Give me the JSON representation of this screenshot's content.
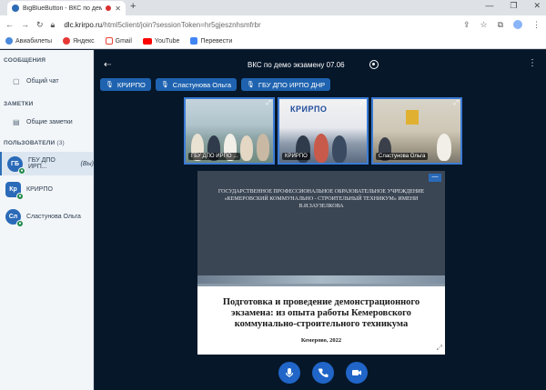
{
  "browser": {
    "tab_title": "BigBlueButton - ВКС по дем...",
    "new_tab": "+",
    "url_host": "dlc.krirpo.ru",
    "url_path": "/html5client/join?sessionToken=hr5gjesznhsmfrbr",
    "bookmarks": [
      {
        "label": "Авиабилеты",
        "icon": "globe-icon",
        "color": "#4a89dc"
      },
      {
        "label": "Яндекс",
        "icon": "yandex-icon",
        "color": "#e53935"
      },
      {
        "label": "Gmail",
        "icon": "gmail-icon",
        "color": "#ea4335"
      },
      {
        "label": "YouTube",
        "icon": "youtube-icon",
        "color": "#ff0000"
      },
      {
        "label": "Перевести",
        "icon": "translate-icon",
        "color": "#4285f4"
      }
    ]
  },
  "sidebar": {
    "messages_title": "СООБЩЕНИЯ",
    "public_chat": "Общий чат",
    "notes_title": "ЗАМЕТКИ",
    "shared_notes": "Общие заметки",
    "users_title": "ПОЛЬЗОВАТЕЛИ",
    "users_count": "(3)",
    "users": [
      {
        "initials": "ГБ",
        "name": "ГБУ ДПО ИРП...",
        "suffix": "(Вы)",
        "color": "#2a6ab8"
      },
      {
        "initials": "Кр",
        "name": "КРИРПО",
        "suffix": "",
        "color": "#2a6ab8"
      },
      {
        "initials": "Сл",
        "name": "Сластунова Ольга",
        "suffix": "",
        "color": "#2a6ab8"
      }
    ]
  },
  "meeting": {
    "title": "ВКС по демо экзамену 07.06",
    "talking_pills": [
      "КРИРПО",
      "Сластунова Ольга",
      "ГБУ ДПО ИРПО ДНР"
    ],
    "videos": [
      {
        "label": "ГБУ ДПО ИРПО ..."
      },
      {
        "label": "КРИРПО"
      },
      {
        "label": "Сластунова Ольга"
      }
    ]
  },
  "slide": {
    "org_text": "ГОСУДАРСТВЕННОЕ ПРОФЕССИОНАЛЬНОЕ ОБРАЗОВАТЕЛЬНОЕ УЧРЕЖДЕНИЕ «КЕМЕРОВСКИЙ КОММУНАЛЬНО - СТРОИТЕЛЬНЫЙ ТЕХНИКУМ» ИМЕНИ В.И.ЗАУЗЕЛКОВА",
    "title": "Подготовка и проведение демонстрационного экзамена: из опыта работы Кемеровского коммунально-строительного техникума",
    "city_year": "Кемерово, 2022"
  },
  "colors": {
    "accent": "#2065c7",
    "panel_bg": "#06172a",
    "sidebar_bg": "#f3f6f9",
    "talking_pill": "#1f63b0",
    "mic_active": "#1e8a4c"
  }
}
